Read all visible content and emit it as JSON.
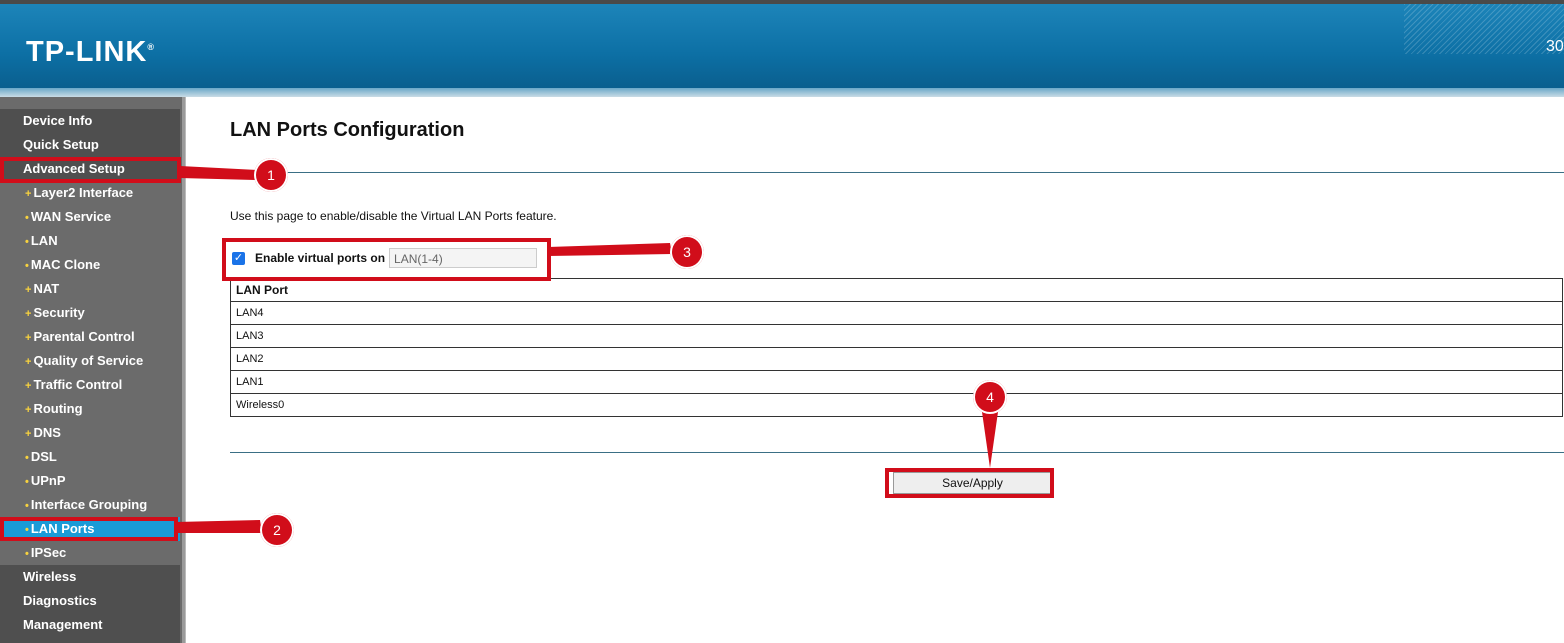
{
  "header": {
    "logo": "TP-LINK",
    "logo_mark": "®",
    "model_partial": "30"
  },
  "sidebar": {
    "items": [
      {
        "label": "Device Info",
        "level": "top"
      },
      {
        "label": "Quick Setup",
        "level": "top"
      },
      {
        "label": "Advanced Setup",
        "level": "top",
        "state": "open"
      },
      {
        "label": "Layer2 Interface",
        "level": "sub",
        "bullet": "+"
      },
      {
        "label": "WAN Service",
        "level": "sub",
        "bullet": "•"
      },
      {
        "label": "LAN",
        "level": "sub",
        "bullet": "•"
      },
      {
        "label": "MAC Clone",
        "level": "sub",
        "bullet": "•"
      },
      {
        "label": "NAT",
        "level": "sub",
        "bullet": "+"
      },
      {
        "label": "Security",
        "level": "sub",
        "bullet": "+"
      },
      {
        "label": "Parental Control",
        "level": "sub",
        "bullet": "+"
      },
      {
        "label": "Quality of Service",
        "level": "sub",
        "bullet": "+"
      },
      {
        "label": "Traffic Control",
        "level": "sub",
        "bullet": "+"
      },
      {
        "label": "Routing",
        "level": "sub",
        "bullet": "+"
      },
      {
        "label": "DNS",
        "level": "sub",
        "bullet": "+"
      },
      {
        "label": "DSL",
        "level": "sub",
        "bullet": "•"
      },
      {
        "label": "UPnP",
        "level": "sub",
        "bullet": "•"
      },
      {
        "label": "Interface Grouping",
        "level": "sub",
        "bullet": "•"
      },
      {
        "label": "LAN Ports",
        "level": "sub",
        "bullet": "•",
        "state": "active"
      },
      {
        "label": "IPSec",
        "level": "sub",
        "bullet": "•"
      },
      {
        "label": "Wireless",
        "level": "top"
      },
      {
        "label": "Diagnostics",
        "level": "top"
      },
      {
        "label": "Management",
        "level": "top"
      }
    ]
  },
  "main": {
    "title": "LAN Ports Configuration",
    "description": "Use this page to enable/disable the Virtual LAN Ports feature.",
    "enable_label": "Enable virtual ports on",
    "enable_checked": true,
    "lan_input_value": "LAN(1-4)",
    "table": {
      "header": "LAN Port",
      "rows": [
        "LAN4",
        "LAN3",
        "LAN2",
        "LAN1",
        "Wireless0"
      ]
    },
    "save_label": "Save/Apply"
  },
  "annotations": {
    "badges": [
      "1",
      "2",
      "3",
      "4"
    ],
    "color": "#d10d1a"
  }
}
